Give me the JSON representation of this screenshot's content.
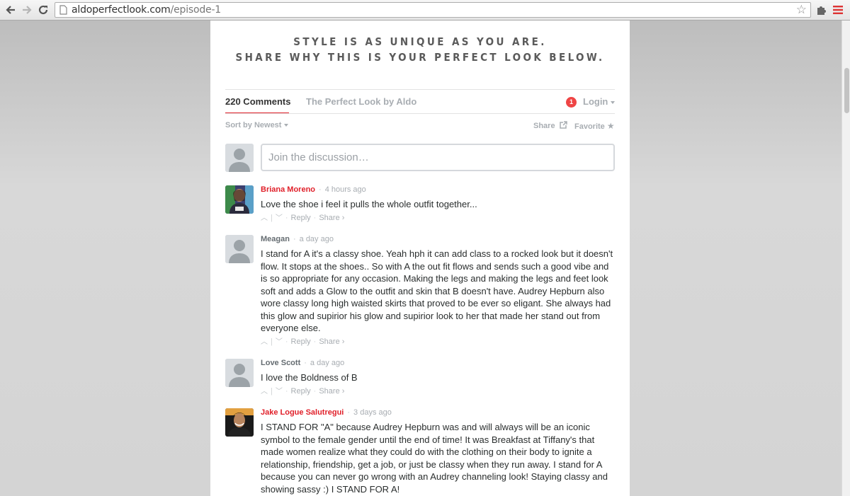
{
  "browser": {
    "url_domain": "aldoperfectlook.com",
    "url_path": "/episode-1"
  },
  "headline": {
    "line1": "STYLE IS AS UNIQUE AS YOU ARE.",
    "line2": "SHARE WHY THIS IS YOUR PERFECT LOOK BELOW."
  },
  "tabs": {
    "comments": "220 Comments",
    "site": "The Perfect Look by Aldo",
    "notification_count": "1",
    "login": "Login"
  },
  "sort": {
    "label": "Sort by Newest",
    "share": "Share",
    "favorite": "Favorite"
  },
  "compose": {
    "placeholder": "Join the discussion…"
  },
  "actions": {
    "reply": "Reply",
    "share": "Share ›"
  },
  "comments": [
    {
      "author": "Briana Moreno",
      "time": "4 hours ago",
      "text": "Love the shoe i feel it pulls the whole outfit together..."
    },
    {
      "author": "Meagan",
      "time": "a day ago",
      "text": "I stand for A it's a classy shoe. Yeah hph it can add class to a rocked look but it doesn't flow. It stops at the shoes.. So with A the out fit flows and sends such a good vibe and is so appropriate for any occasion. Making the legs and making the legs and feet look soft and adds a Glow to the outfit and skin that B doesn't have. Audrey Hepburn also wore classy long high waisted skirts that proved to be ever so eligant. She always had this glow and supirior his glow and supirior look to her that made her stand out from everyone else."
    },
    {
      "author": "Love Scott",
      "time": "a day ago",
      "text": "I love the Boldness of B"
    },
    {
      "author": "Jake Logue Salutregui",
      "time": "3 days ago",
      "text": "I STAND FOR \"A\" because Audrey Hepburn was and will always will be an iconic symbol to the female gender until the end of time! It was Breakfast at Tiffany's that made women realize what they could do with the clothing on their body to ignite a relationship, friendship, get a job, or just be classy when they run away. I stand for A because you can never go wrong with an Audrey channeling look! Staying classy and showing sassy :) I STAND FOR A!"
    }
  ],
  "colors": {
    "accent": "#e0202a",
    "muted": "#a8adb2",
    "text": "#2a2e2e"
  },
  "icons": {
    "back": "back-arrow-icon",
    "forward": "forward-arrow-icon",
    "reload": "reload-icon",
    "bookmark": "star-icon",
    "extension": "puzzle-icon",
    "menu": "hamburger-menu-icon"
  }
}
